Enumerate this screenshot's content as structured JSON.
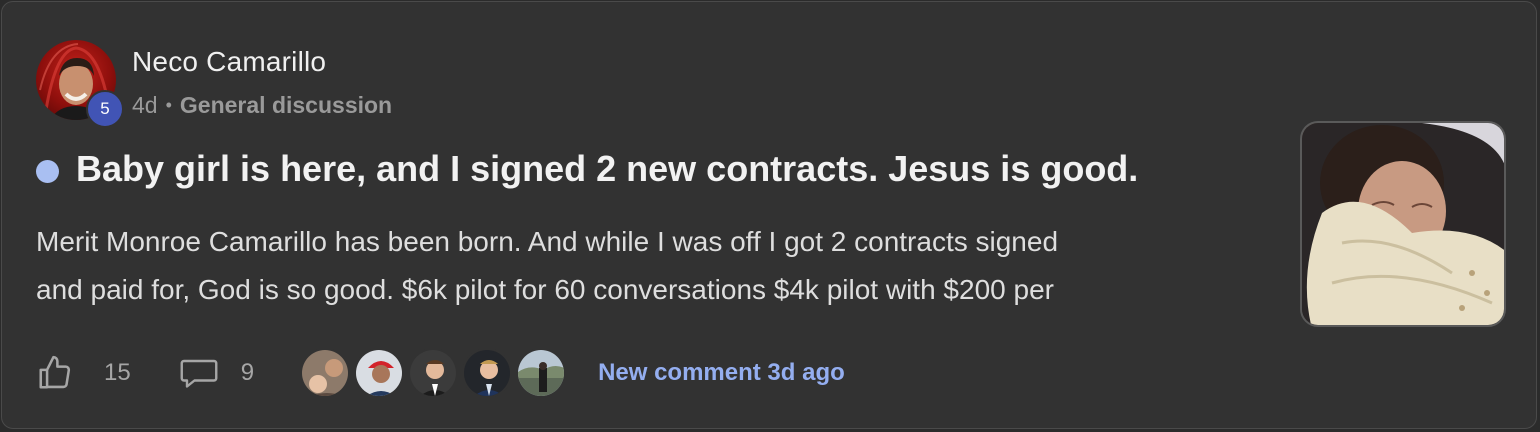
{
  "post": {
    "author": "Neco Camarillo",
    "level": "5",
    "age": "4d",
    "separator": "•",
    "category": "General discussion",
    "title": "Baby girl is here, and I signed 2 new contracts. Jesus is good.",
    "excerpt_line1": "Merit Monroe Camarillo has been born. And while I was off I got 2 contracts signed",
    "excerpt_line2": "and paid for, God is so good. $6k pilot for 60 conversations $4k pilot with $200 per"
  },
  "footer": {
    "likes": "15",
    "comments": "9",
    "new_comment": "New comment 3d ago",
    "commenter_avatars": [
      "commenter-1",
      "commenter-2",
      "commenter-3",
      "commenter-4",
      "commenter-5"
    ]
  },
  "colors": {
    "accent_unread": "#a9bff2",
    "link": "#94aef0",
    "level_badge": "#4154b5",
    "card_bg": "#323232"
  },
  "icons": {
    "like": "thumbs-up-icon",
    "comment": "comment-bubble-icon"
  }
}
